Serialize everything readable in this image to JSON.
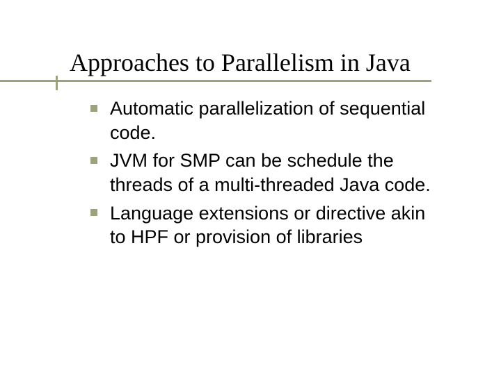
{
  "title": "Approaches to Parallelism in Java",
  "bullets": [
    "Automatic parallelization of sequential code.",
    "JVM for SMP can be schedule the threads of a multi-threaded Java code.",
    "Language extensions or directive akin to HPF or provision of libraries"
  ]
}
